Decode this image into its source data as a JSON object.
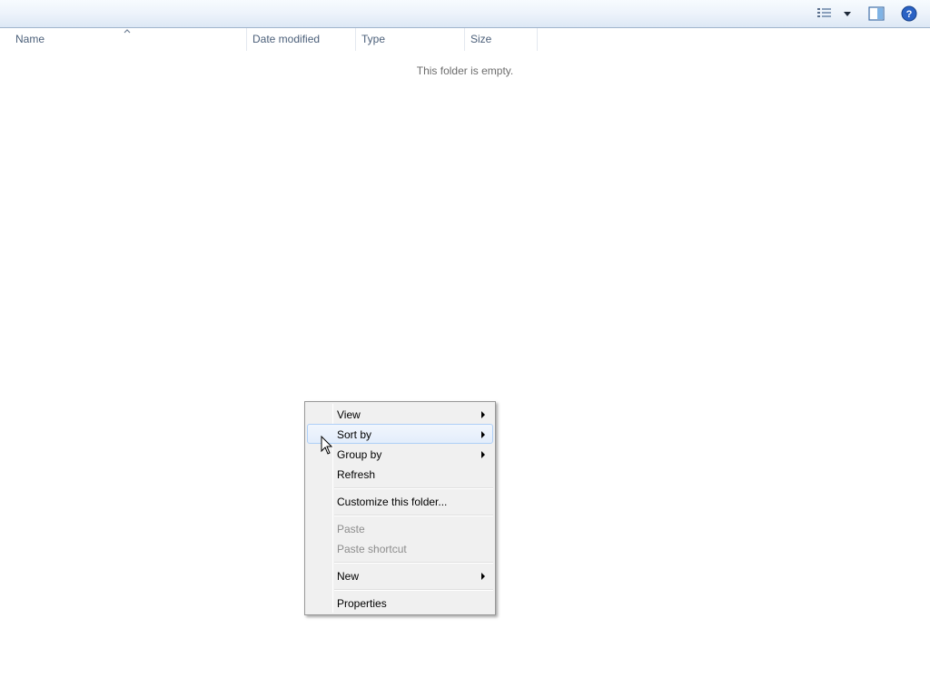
{
  "toolbar": {
    "icons": [
      "views-icon",
      "dropdown-arrow-icon",
      "preview-pane-icon",
      "help-icon"
    ]
  },
  "columns": {
    "name": "Name",
    "date_modified": "Date modified",
    "type": "Type",
    "size": "Size"
  },
  "empty_message": "This folder is empty.",
  "context_menu": {
    "view": "View",
    "sort_by": "Sort by",
    "group_by": "Group by",
    "refresh": "Refresh",
    "customize": "Customize this folder...",
    "paste": "Paste",
    "paste_shortcut": "Paste shortcut",
    "new": "New",
    "properties": "Properties",
    "highlighted": "Sort by"
  },
  "colors": {
    "accent": "#1f5fbf",
    "menu_bg": "#f0f0f0",
    "hover_border": "#aecff7"
  }
}
